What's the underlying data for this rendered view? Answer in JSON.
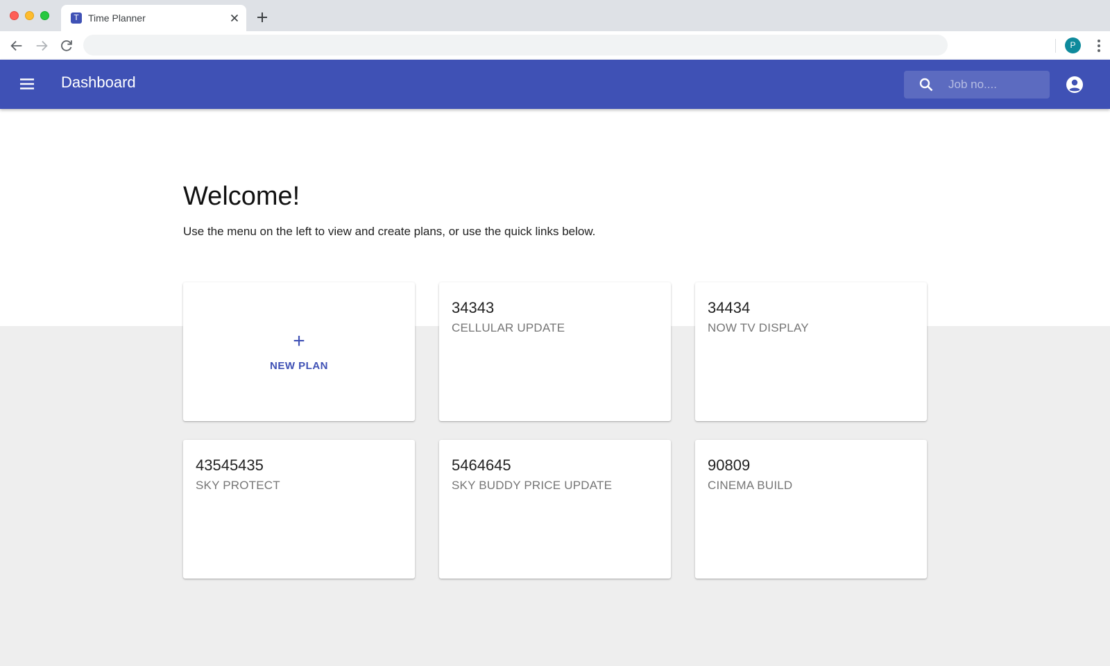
{
  "browser": {
    "tab_title": "Time Planner",
    "tab_favicon_letter": "T",
    "profile_initial": "P"
  },
  "appbar": {
    "title": "Dashboard",
    "search_placeholder": "Job no...."
  },
  "main": {
    "heading": "Welcome!",
    "subtitle": "Use the menu on the left to view and create plans, or use the quick links below.",
    "new_plan": {
      "plus": "+",
      "label": "NEW PLAN"
    },
    "plans": [
      {
        "number": "34343",
        "name": "CELLULAR UPDATE"
      },
      {
        "number": "34434",
        "name": "NOW TV DISPLAY"
      },
      {
        "number": "43545435",
        "name": "SKY PROTECT"
      },
      {
        "number": "5464645",
        "name": "SKY BUDDY PRICE UPDATE"
      },
      {
        "number": "90809",
        "name": "CINEMA BUILD"
      }
    ]
  },
  "colors": {
    "primary": "#3f51b5",
    "primary_light": "#5c6bc0",
    "background_band": "#eeeeee"
  }
}
